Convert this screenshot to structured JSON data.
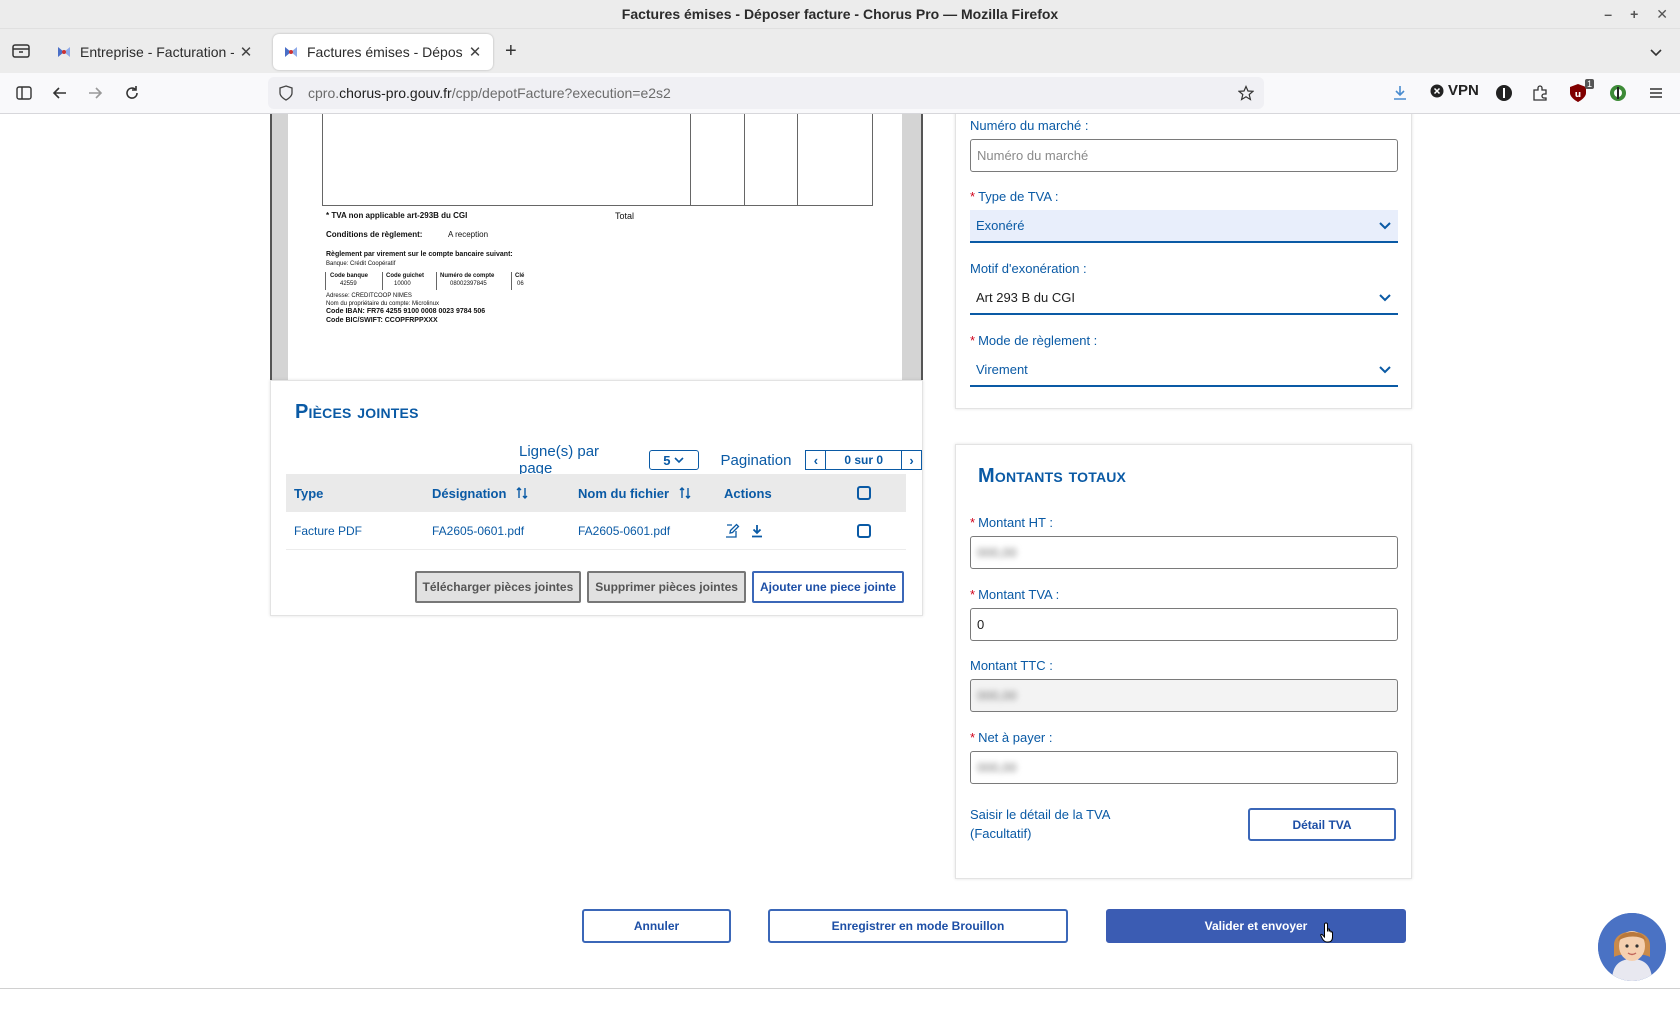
{
  "window": {
    "title": "Factures émises - Déposer facture - Chorus Pro — Mozilla Firefox"
  },
  "tabs": [
    {
      "label": "Entreprise - Facturation - Po"
    },
    {
      "label": "Factures émises - Déposer f"
    }
  ],
  "urlbar": {
    "prefix": "cpro.",
    "domain": "chorus-pro.gouv.fr",
    "path": "/cpp/depotFacture?execution=e2s2"
  },
  "toolbar": {
    "vpn_label": "VPN",
    "extension_badge": "1"
  },
  "pdf_preview": {
    "tva_note": "* TVA non applicable art-293B du CGI",
    "total_label": "Total",
    "conditions_label": "Conditions de règlement:",
    "conditions_value": "A reception",
    "virement_label": "Règlement par virement sur le compte bancaire suivant:",
    "banque": "Banque: Crédit Coopératif",
    "bank_headers": [
      "Code banque",
      "Code guichet",
      "Numéro de compte",
      "Clé"
    ],
    "bank_values": [
      "42559",
      "10000",
      "08002397845",
      "06"
    ],
    "adresse": "Adresse: CREDITCOOP NIMES",
    "proprietaire": "Nom du propriétaire du compte: Microlinux",
    "iban": "Code IBAN: FR76 4255 9100 0008 0023 9784 506",
    "bic": "Code BIC/SWIFT: CCOPFRPPXXX"
  },
  "pieces_jointes": {
    "title": "Pièces jointes",
    "lines_per_page_label": "Ligne(s) par page",
    "lines_per_page_value": "5",
    "pagination_label": "Pagination",
    "pagination_value": "0 sur 0",
    "columns": [
      "Type",
      "Désignation",
      "Nom du fichier",
      "Actions"
    ],
    "rows": [
      {
        "type": "Facture PDF",
        "designation": "FA2605-0601.pdf",
        "filename": "FA2605-0601.pdf"
      }
    ],
    "buttons": {
      "download": "Télécharger pièces jointes",
      "delete": "Supprimer pièces jointes",
      "add": "Ajouter une piece jointe"
    }
  },
  "form": {
    "numero_marche": {
      "label": "Numéro du marché :",
      "placeholder": "Numéro du marché"
    },
    "type_tva": {
      "label": "Type de TVA :",
      "value": "Exonéré"
    },
    "motif_exoneration": {
      "label": "Motif d'exonération :",
      "value": "Art 293 B du CGI"
    },
    "mode_reglement": {
      "label": "Mode de règlement :",
      "value": "Virement"
    }
  },
  "totals": {
    "title": "Montants totaux",
    "montant_ht": {
      "label": "Montant HT :",
      "value": "000,00"
    },
    "montant_tva": {
      "label": "Montant TVA :",
      "value": "0"
    },
    "montant_ttc": {
      "label": "Montant TTC :",
      "value": "000,00"
    },
    "net_a_payer": {
      "label": "Net à payer :",
      "value": "000,00"
    },
    "detail_text_1": "Saisir le détail de la TVA",
    "detail_text_2": "(Facultatif)",
    "detail_button": "Détail TVA"
  },
  "footer": {
    "annuler": "Annuler",
    "brouillon": "Enregistrer en mode Brouillon",
    "valider": "Valider et envoyer"
  },
  "colors": {
    "primary_blue": "#0a5aa5",
    "button_blue": "#3b5cb3",
    "required_red": "#d0021b"
  }
}
